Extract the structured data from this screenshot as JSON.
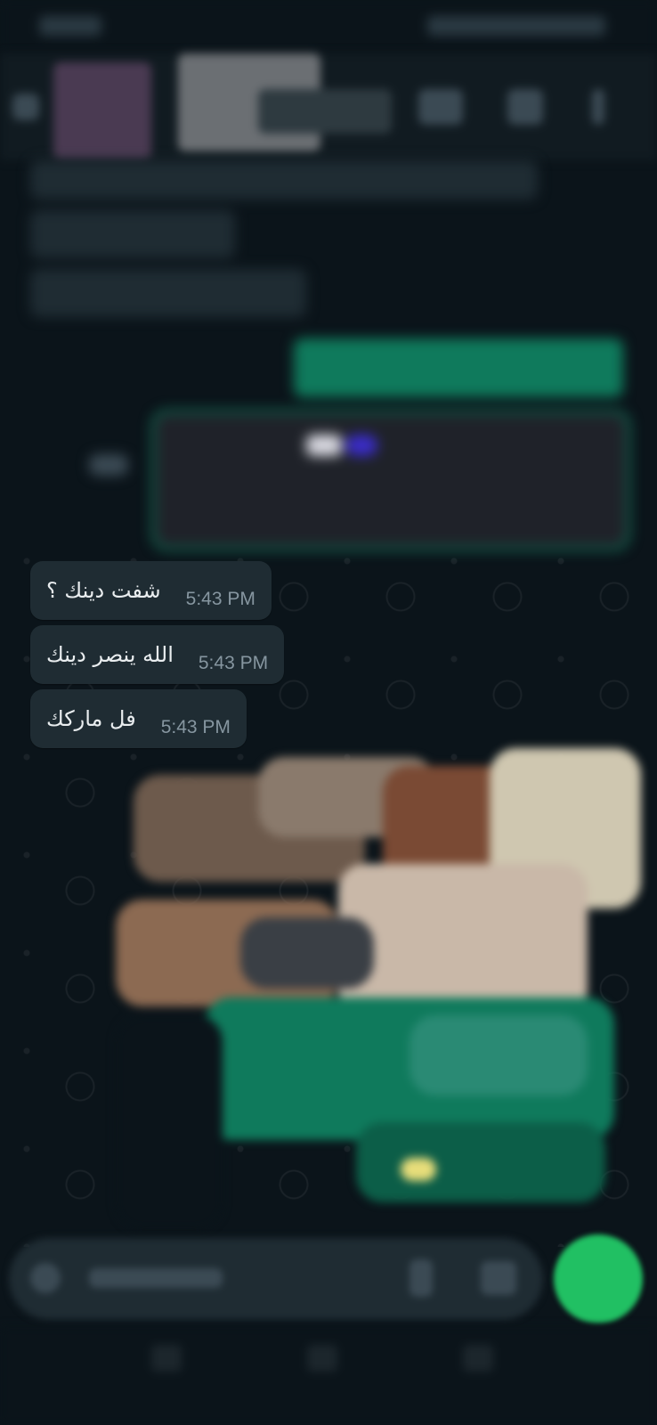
{
  "messages": [
    {
      "text": "شفت دينك ؟",
      "time": "5:43 PM"
    },
    {
      "text": "الله ينصر دينك",
      "time": "5:43 PM"
    },
    {
      "text": "فل ماركك",
      "time": "5:43 PM"
    }
  ],
  "colors": {
    "background": "#0b141a",
    "incoming_bubble": "#1f2c33",
    "outgoing_bubble": "#005c4b",
    "send_button": "#21c063",
    "timestamp": "#8696a0"
  },
  "icons": [
    "video-call-icon",
    "phone-icon",
    "more-options-icon",
    "emoji-icon",
    "attach-icon",
    "camera-icon",
    "mic-icon"
  ]
}
